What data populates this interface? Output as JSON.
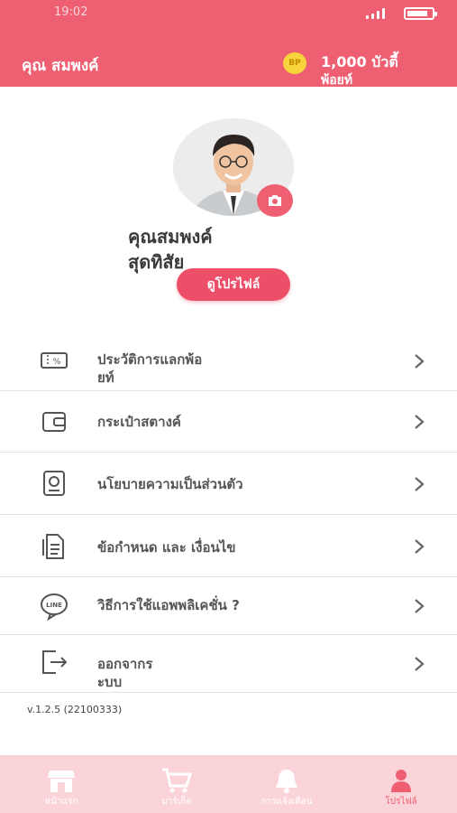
{
  "status_bar": {
    "time": "19:02"
  },
  "header": {
    "user_name": "คุณ สมพงค์",
    "points_coin_label": "BP",
    "points_value": "1,000 บัวตี้",
    "points_unit_line2": "พ้อยท์"
  },
  "profile": {
    "full_name_line1": "คุณสมพงค์",
    "full_name_line2": "สุดทิสัย",
    "view_profile_label": "ดูโปรไฟล์"
  },
  "menu": [
    {
      "label_line1": "ประวัติการแลกพ้อ",
      "label_line2": "ยท์",
      "icon": "coupon-icon"
    },
    {
      "label_line1": "กระเป๋าสตางค์",
      "label_line2": "",
      "icon": "wallet-icon"
    },
    {
      "label_line1": "นโยบายความเป็นส่วนตัว",
      "label_line2": "",
      "icon": "privacy-icon"
    },
    {
      "label_line1": "ข้อกำหนด และ เงื่อนไข",
      "label_line2": "",
      "icon": "document-icon"
    },
    {
      "label_line1": "วิธีการใช้แอพพลิเคชั่น ?",
      "label_line2": "",
      "icon": "line-icon"
    },
    {
      "label_line1": "ออกจากร",
      "label_line2": "ะบบ",
      "icon": "logout-icon"
    }
  ],
  "version": "v.1.2.5 (22100333)",
  "bottom_nav": [
    {
      "label": "หน้าแรก",
      "icon": "store-icon"
    },
    {
      "label": "มาร์เก็ต",
      "icon": "cart-icon"
    },
    {
      "label": "การแจ้งเตือน",
      "icon": "bell-icon"
    },
    {
      "label": "โปรไฟล์",
      "icon": "person-icon",
      "active": true
    }
  ],
  "colors": {
    "brand": "#ee5f72",
    "nav_bg": "#fbd4d9",
    "coin": "#f7d33c"
  }
}
